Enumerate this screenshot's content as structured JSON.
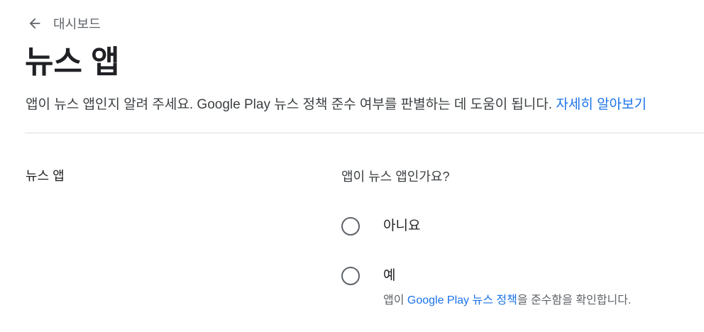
{
  "nav": {
    "back_label": "대시보드"
  },
  "header": {
    "title": "뉴스 앱"
  },
  "description": {
    "text": "앱이 뉴스 앱인지 알려 주세요. Google Play 뉴스 정책 준수 여부를 판별하는 데 도움이 됩니다.",
    "link_label": "자세히 알아보기"
  },
  "section": {
    "label": "뉴스 앱",
    "question": "앱이 뉴스 앱인가요?",
    "options": [
      {
        "label": "아니요",
        "selected": false
      },
      {
        "label": "예",
        "selected": false,
        "sub_prefix": "앱이 ",
        "sub_link": "Google Play 뉴스 정책",
        "sub_suffix": "을 준수함을 확인합니다."
      }
    ]
  },
  "icons": {
    "back": "arrow-back-icon"
  },
  "colors": {
    "link": "#1a73e8",
    "divider": "#dadce0",
    "radio_border": "#5f6368"
  }
}
